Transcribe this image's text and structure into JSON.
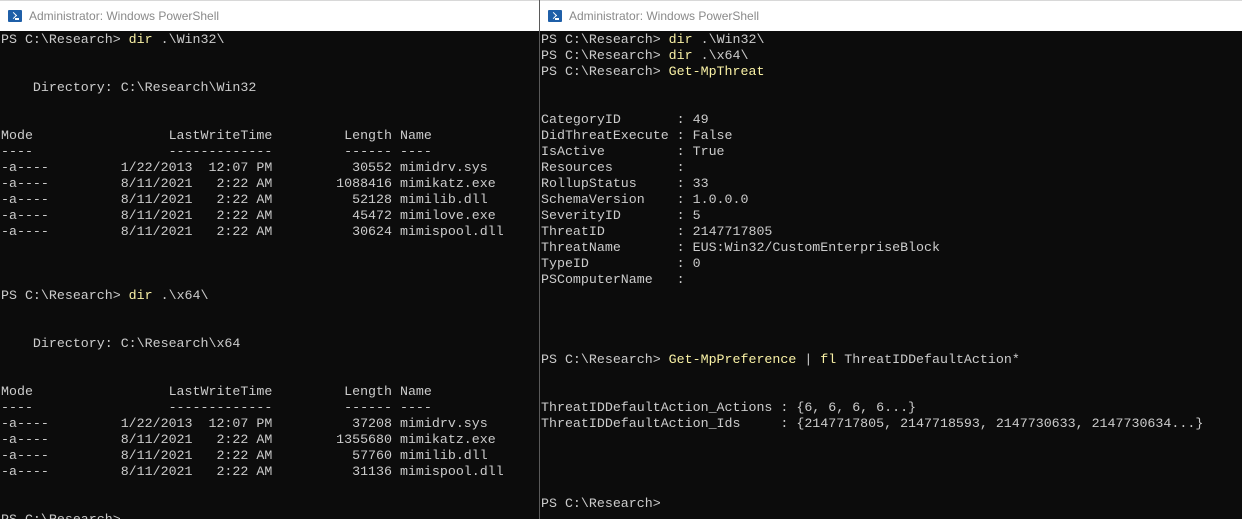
{
  "left_window": {
    "title": "Administrator: Windows PowerShell",
    "lines": [
      {
        "prompt": "PS C:\\Research> ",
        "cmd": "dir",
        "rest": " .\\Win32\\"
      },
      {
        "text": ""
      },
      {
        "text": ""
      },
      {
        "text": "    Directory: C:\\Research\\Win32"
      },
      {
        "text": ""
      },
      {
        "text": ""
      },
      {
        "text": "Mode                 LastWriteTime         Length Name"
      },
      {
        "text": "----                 -------------         ------ ----"
      },
      {
        "text": "-a----         1/22/2013  12:07 PM          30552 mimidrv.sys"
      },
      {
        "text": "-a----         8/11/2021   2:22 AM        1088416 mimikatz.exe"
      },
      {
        "text": "-a----         8/11/2021   2:22 AM          52128 mimilib.dll"
      },
      {
        "text": "-a----         8/11/2021   2:22 AM          45472 mimilove.exe"
      },
      {
        "text": "-a----         8/11/2021   2:22 AM          30624 mimispool.dll"
      },
      {
        "text": ""
      },
      {
        "text": ""
      },
      {
        "text": ""
      },
      {
        "prompt": "PS C:\\Research> ",
        "cmd": "dir",
        "rest": " .\\x64\\"
      },
      {
        "text": ""
      },
      {
        "text": ""
      },
      {
        "text": "    Directory: C:\\Research\\x64"
      },
      {
        "text": ""
      },
      {
        "text": ""
      },
      {
        "text": "Mode                 LastWriteTime         Length Name"
      },
      {
        "text": "----                 -------------         ------ ----"
      },
      {
        "text": "-a----         1/22/2013  12:07 PM          37208 mimidrv.sys"
      },
      {
        "text": "-a----         8/11/2021   2:22 AM        1355680 mimikatz.exe"
      },
      {
        "text": "-a----         8/11/2021   2:22 AM          57760 mimilib.dll"
      },
      {
        "text": "-a----         8/11/2021   2:22 AM          31136 mimispool.dll"
      },
      {
        "text": ""
      },
      {
        "text": ""
      },
      {
        "prompt": "PS C:\\Research>",
        "cmd": "",
        "rest": ""
      }
    ]
  },
  "right_window": {
    "title": "Administrator: Windows PowerShell",
    "lines": [
      {
        "prompt": "PS C:\\Research> ",
        "cmd": "dir",
        "rest": " .\\Win32\\"
      },
      {
        "prompt": "PS C:\\Research> ",
        "cmd": "dir",
        "rest": " .\\x64\\"
      },
      {
        "prompt": "PS C:\\Research> ",
        "cmd": "Get-MpThreat",
        "rest": ""
      },
      {
        "text": ""
      },
      {
        "text": ""
      },
      {
        "text": "CategoryID       : 49"
      },
      {
        "text": "DidThreatExecute : False"
      },
      {
        "text": "IsActive         : True"
      },
      {
        "text": "Resources        :"
      },
      {
        "text": "RollupStatus     : 33"
      },
      {
        "text": "SchemaVersion    : 1.0.0.0"
      },
      {
        "text": "SeverityID       : 5"
      },
      {
        "text": "ThreatID         : 2147717805"
      },
      {
        "text": "ThreatName       : EUS:Win32/CustomEnterpriseBlock"
      },
      {
        "text": "TypeID           : 0"
      },
      {
        "text": "PSComputerName   :"
      },
      {
        "text": ""
      },
      {
        "text": ""
      },
      {
        "text": ""
      },
      {
        "text": ""
      },
      {
        "prompt": "PS C:\\Research> ",
        "cmd": "Get-MpPreference",
        "pipe": " | ",
        "cmd2": "fl",
        "rest": " ThreatIDDefaultAction*"
      },
      {
        "text": ""
      },
      {
        "text": ""
      },
      {
        "text": "ThreatIDDefaultAction_Actions : {6, 6, 6, 6...}"
      },
      {
        "text": "ThreatIDDefaultAction_Ids     : {2147717805, 2147718593, 2147730633, 2147730634...}"
      },
      {
        "text": ""
      },
      {
        "text": ""
      },
      {
        "text": ""
      },
      {
        "text": ""
      },
      {
        "prompt": "PS C:\\Research>",
        "cmd": "",
        "rest": ""
      }
    ]
  },
  "colors": {
    "background": "#0c0c0c",
    "foreground": "#cccccc",
    "command": "#f9f1a5",
    "titlebar": "#ffffff",
    "title_text": "#8a8a8a"
  },
  "icons": {
    "window_icon": "powershell-icon"
  }
}
